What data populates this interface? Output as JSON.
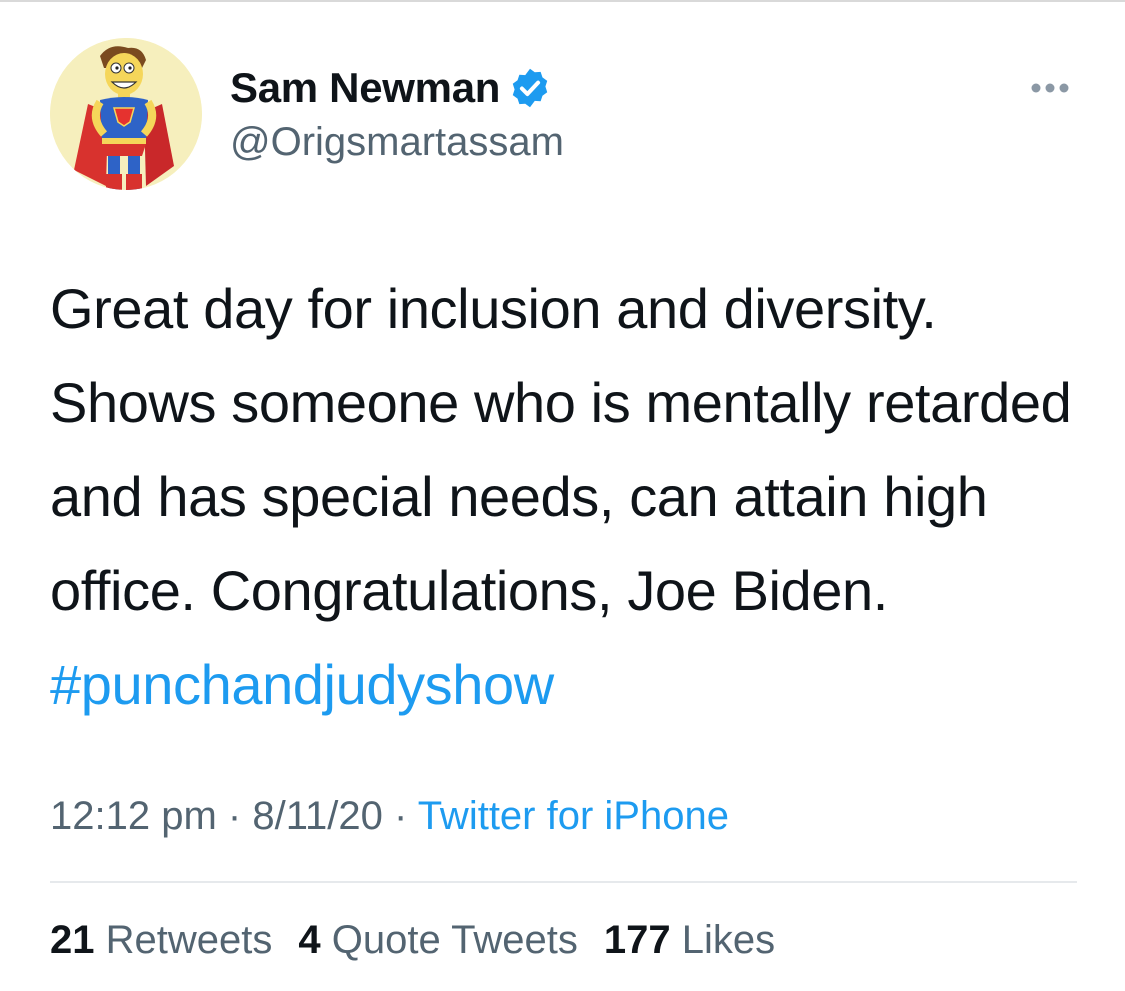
{
  "tweet": {
    "author": {
      "display_name": "Sam Newman",
      "handle": "@Origsmartassam",
      "verified": true,
      "avatar_icon": "superhero-cartoon-avatar"
    },
    "text_before_hashtag": "Great day for inclusion and diversity. Shows someone who is mentally retarded and has special needs, can attain high office. Congratulations, Joe Biden.",
    "hashtag": "#punchandjudyshow",
    "time": "12:12 pm",
    "date": "8/11/20",
    "source": "Twitter for iPhone",
    "separator": "·",
    "stats": {
      "retweets": {
        "count": "21",
        "label": "Retweets"
      },
      "quote_tweets": {
        "count": "4",
        "label": "Quote Tweets"
      },
      "likes": {
        "count": "177",
        "label": "Likes"
      }
    }
  },
  "colors": {
    "link": "#1d9bf0",
    "secondary_text": "#536471",
    "primary_text": "#0f1419"
  }
}
